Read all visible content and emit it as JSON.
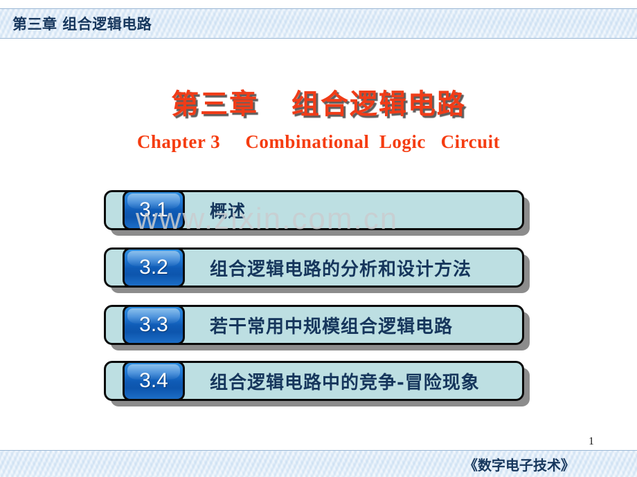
{
  "header": {
    "title": "第三章 组合逻辑电路"
  },
  "title": {
    "main": "第三章   组合逻辑电路",
    "sub": "Chapter 3     Combinational  Logic   Circuit"
  },
  "watermark": {
    "text": "www.zixin.com.cn"
  },
  "sections": [
    {
      "number": "3.1",
      "label": "概述"
    },
    {
      "number": "3.2",
      "label": "组合逻辑电路的分析和设计方法"
    },
    {
      "number": "3.3",
      "label": "若干常用中规模组合逻辑电路"
    },
    {
      "number": "3.4",
      "label": "组合逻辑电路中的竞争-冒险现象"
    }
  ],
  "footer": {
    "page_number": "1",
    "book_title": "《数字电子技术》"
  },
  "colors": {
    "title_red": "#f03c18",
    "subtitle_red": "#f53c10",
    "navy": "#16365c",
    "bar_fill": "#bddfe2",
    "badge_blue": "#0f5bb5",
    "band_blue": "#d5e6f7"
  }
}
